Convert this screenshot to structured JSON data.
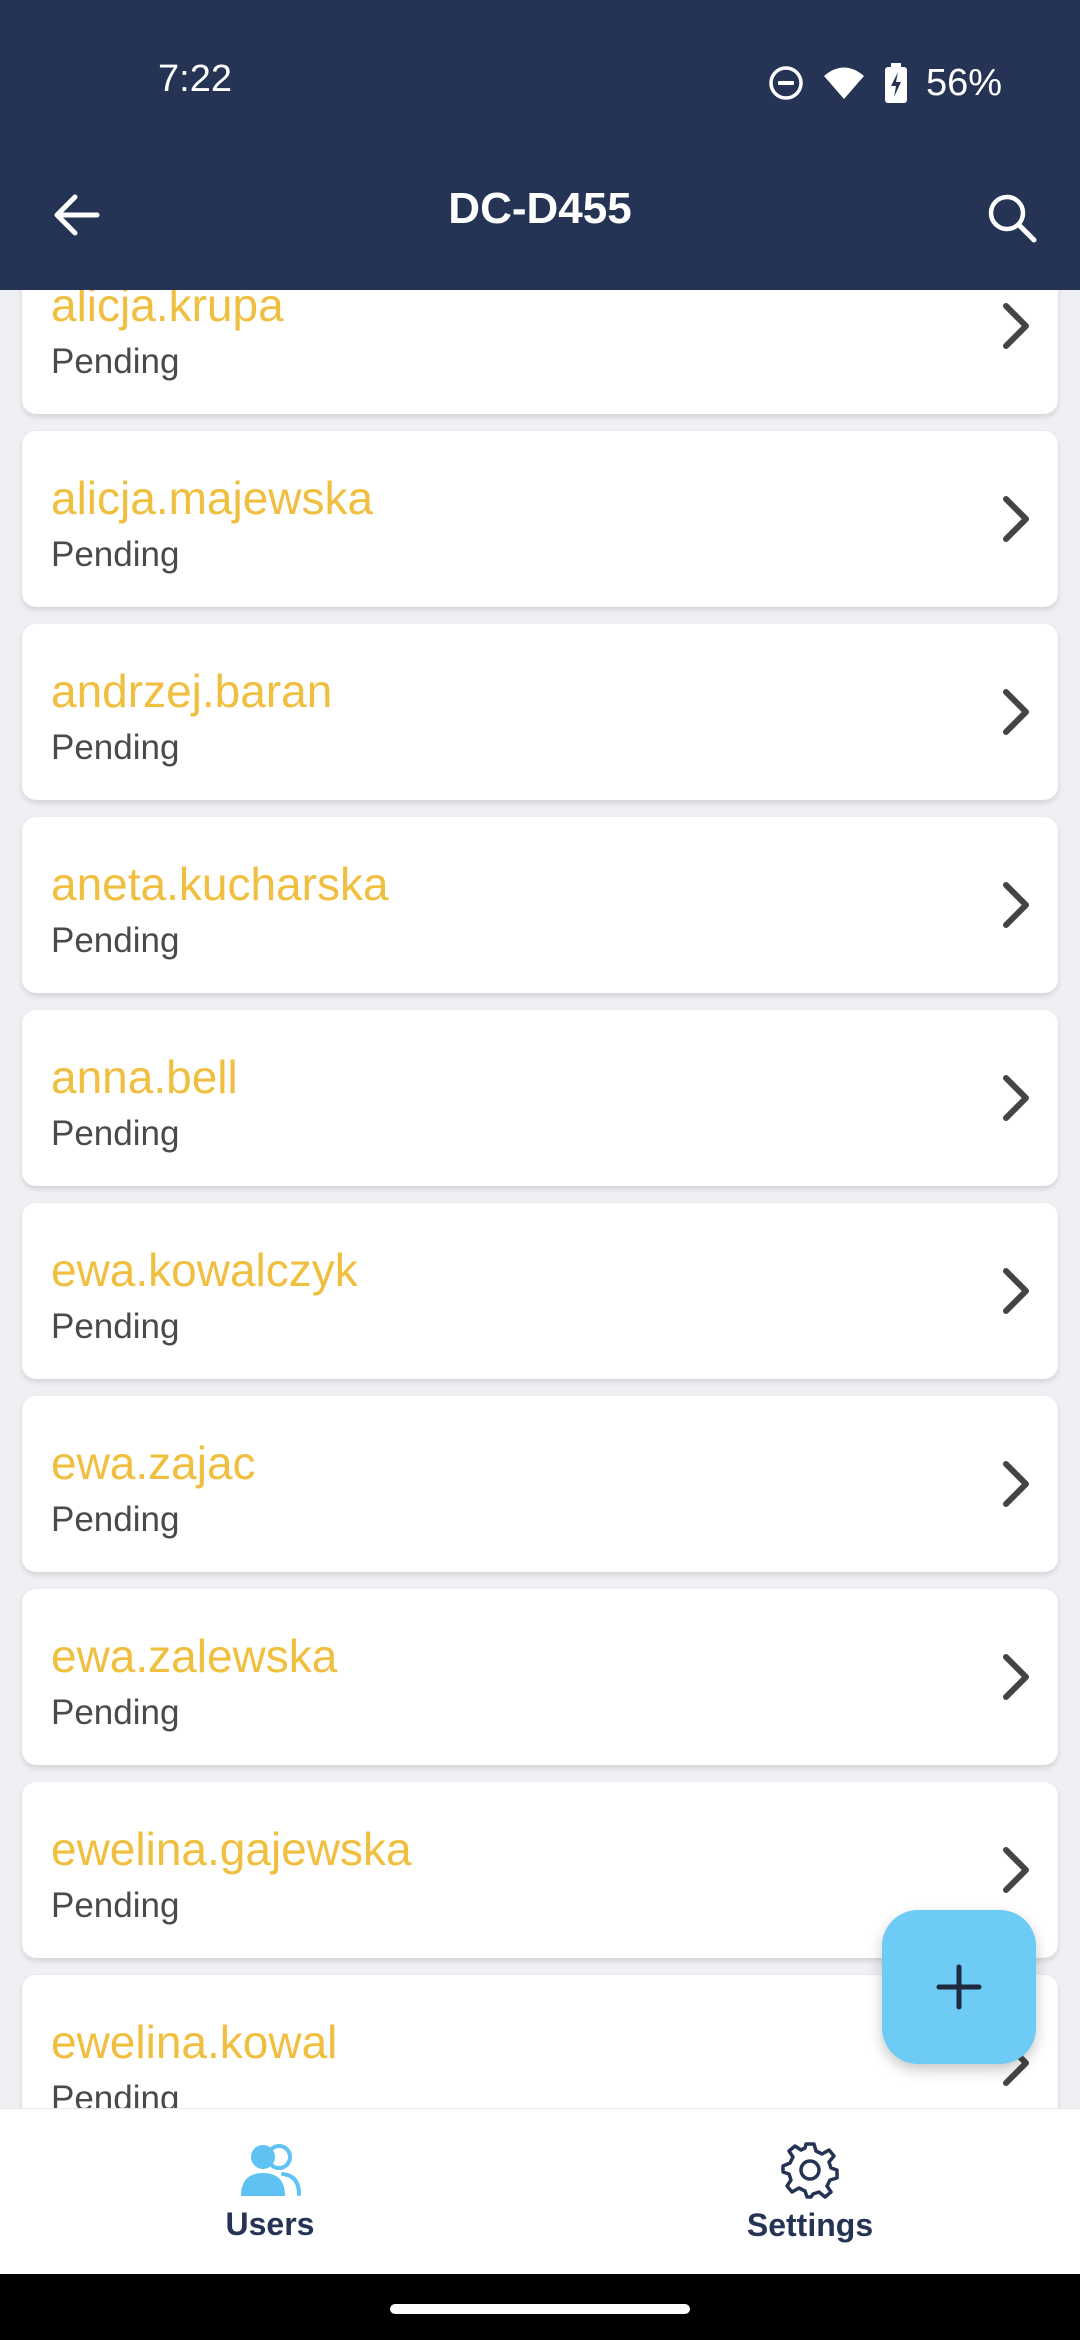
{
  "status_bar": {
    "time": "7:22",
    "battery_percent": "56%",
    "icons": [
      "do-not-disturb-icon",
      "wifi-icon",
      "battery-charging-icon"
    ]
  },
  "app_bar": {
    "title": "DC-D455",
    "back_icon": "arrow-left-icon",
    "search_icon": "search-icon"
  },
  "users": [
    {
      "name": "alicja.krupa",
      "status": "Pending"
    },
    {
      "name": "alicja.majewska",
      "status": "Pending"
    },
    {
      "name": "andrzej.baran",
      "status": "Pending"
    },
    {
      "name": "aneta.kucharska",
      "status": "Pending"
    },
    {
      "name": "anna.bell",
      "status": "Pending"
    },
    {
      "name": "ewa.kowalczyk",
      "status": "Pending"
    },
    {
      "name": "ewa.zajac",
      "status": "Pending"
    },
    {
      "name": "ewa.zalewska",
      "status": "Pending"
    },
    {
      "name": "ewelina.gajewska",
      "status": "Pending"
    },
    {
      "name": "ewelina.kowal",
      "status": "Pending"
    }
  ],
  "fab": {
    "icon": "plus-icon"
  },
  "bottom_nav": {
    "items": [
      {
        "label": "Users",
        "icon": "users-icon",
        "active": true
      },
      {
        "label": "Settings",
        "icon": "gear-icon",
        "active": false
      }
    ]
  },
  "colors": {
    "app_bar": "#253354",
    "name_text": "#f0bf3f",
    "fab": "#6ecbf5",
    "active_nav_icon": "#5ec3f2"
  }
}
